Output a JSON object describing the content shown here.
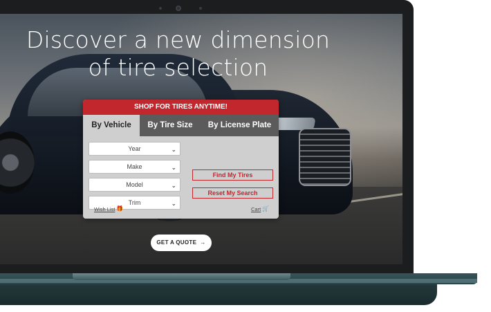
{
  "hero": {
    "title_line1": "Discover a new dimension",
    "title_line2": "of tire selection"
  },
  "widget": {
    "header": "SHOP FOR TIRES ANYTIME!",
    "tabs": [
      {
        "label": "By Vehicle",
        "active": true
      },
      {
        "label": "By Tire Size",
        "active": false
      },
      {
        "label": "By License Plate",
        "active": false
      }
    ],
    "selects": [
      {
        "value": "Year"
      },
      {
        "value": "Make"
      },
      {
        "value": "Model"
      },
      {
        "value": "Trim"
      }
    ],
    "find_button": "Find My Tires",
    "reset_button": "Reset My Search",
    "wish_list": "Wish List",
    "cart": "Cart",
    "colors": {
      "accent": "#c1272d",
      "panel": "#cfcfcf",
      "tab_bar": "#5b5b5b"
    }
  },
  "cta": {
    "label": "GET A QUOTE",
    "icon": "arrow-right-icon"
  }
}
